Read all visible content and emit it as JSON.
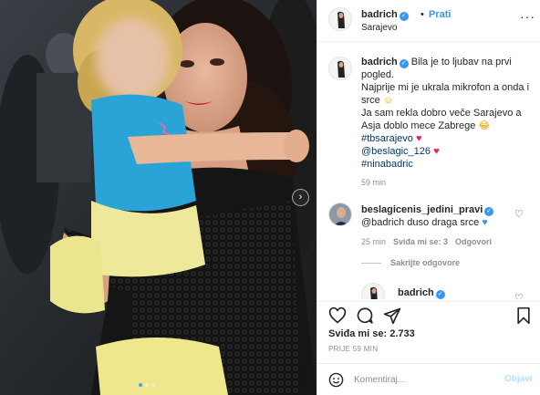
{
  "photo": {
    "carousel_next_glyph": "›",
    "dots": 3,
    "active_dot": 0
  },
  "header": {
    "username": "badrich",
    "verified_glyph": "✓",
    "separator": "•",
    "follow_label": "Prati",
    "location": "Sarajevo",
    "more_glyph": "···"
  },
  "caption": {
    "username": "badrich",
    "text_line1": "Bila je to ljubav na prvi pogled.",
    "text_line2": "Najprije mi je ukrala mikrofon a onda i srce",
    "text_line3": "Ja sam rekla dobro veče Sarajevo a Asja doblo mece Zabrege",
    "hashtag1": "#tbsarajevo",
    "mention": "@beslagic_126",
    "hashtag2": "#ninabadric",
    "time": "59 min"
  },
  "comment": {
    "username": "beslagicenis_jedini_pravi",
    "text": "@badrich duso draga srce",
    "time": "25 min",
    "likes": "Sviđa mi se: 3",
    "reply_label": "Odgovori"
  },
  "hide_replies_label": "Sakrijte odgovore",
  "reply": {
    "username": "badrich"
  },
  "actions": {
    "likes_text": "Sviđa mi se: 2.733",
    "date_text": "PRIJE 59 MIN"
  },
  "comment_box": {
    "placeholder": "Komentiraj...",
    "post_label": "Objavi"
  },
  "colors": {
    "accent": "#3897f0",
    "heart": "#e0245e",
    "shirt": "#2aa3d6",
    "dress": "#151515"
  }
}
